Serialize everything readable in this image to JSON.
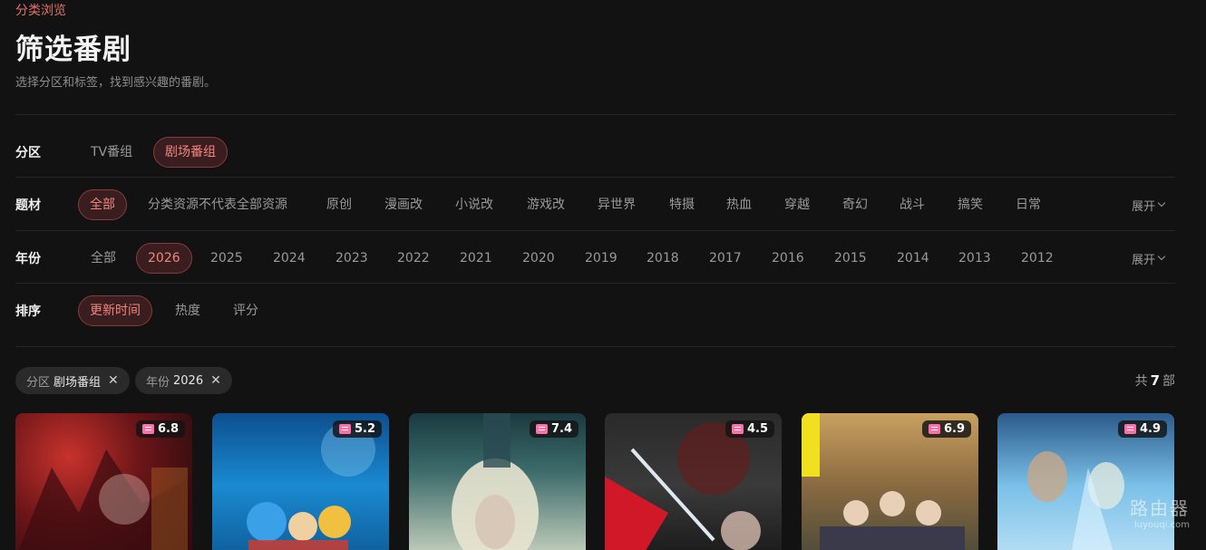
{
  "header": {
    "breadcrumb": "分类浏览",
    "title": "筛选番剧",
    "subtitle": "选择分区和标签，找到感兴趣的番剧。"
  },
  "filters": {
    "zone": {
      "label": "分区",
      "options": [
        "TV番组",
        "剧场番组"
      ],
      "selected": "剧场番组"
    },
    "genre": {
      "label": "题材",
      "options": [
        "全部",
        "分类资源不代表全部资源",
        "原创",
        "漫画改",
        "小说改",
        "游戏改",
        "异世界",
        "特摄",
        "热血",
        "穿越",
        "奇幻",
        "战斗",
        "搞笑",
        "日常"
      ],
      "selected": "全部",
      "expand": "展开"
    },
    "year": {
      "label": "年份",
      "options": [
        "全部",
        "2026",
        "2025",
        "2024",
        "2023",
        "2022",
        "2021",
        "2020",
        "2019",
        "2018",
        "2017",
        "2016",
        "2015",
        "2014",
        "2013",
        "2012"
      ],
      "selected": "2026",
      "expand": "展开"
    },
    "sort": {
      "label": "排序",
      "options": [
        "更新时间",
        "热度",
        "评分"
      ],
      "selected": "更新时间"
    }
  },
  "active_tags": [
    {
      "key": "分区",
      "value": "剧场番组"
    },
    {
      "key": "年份",
      "value": "2026"
    }
  ],
  "result_count": {
    "prefix": "共",
    "count": "7",
    "suffix": "部"
  },
  "cards": [
    {
      "rating": "6.8"
    },
    {
      "rating": "5.2"
    },
    {
      "rating": "7.4"
    },
    {
      "rating": "4.5"
    },
    {
      "rating": "6.9"
    },
    {
      "rating": "4.9"
    }
  ],
  "watermark": {
    "line1": "路由器",
    "line2": "luyouqi.com"
  },
  "colors": {
    "accent": "#f0867d",
    "background": "#121212"
  }
}
